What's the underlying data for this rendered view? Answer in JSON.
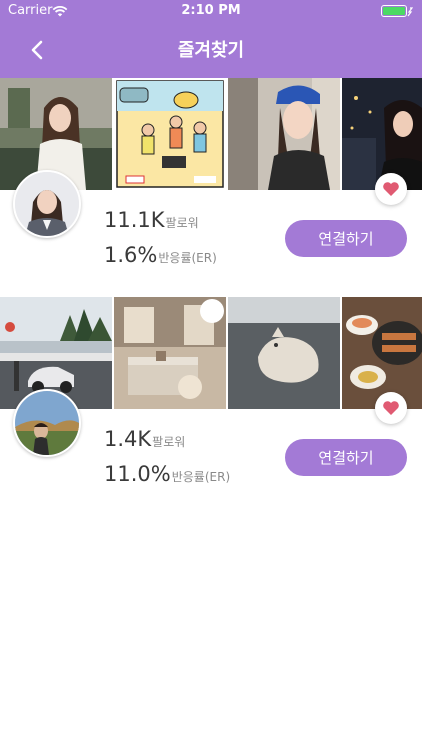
{
  "status_bar": {
    "carrier": "Carrier",
    "time": "2:10 PM",
    "battery_icon": "battery-full-icon",
    "wifi_icon": "wifi-icon"
  },
  "nav": {
    "title": "즐겨찾기",
    "back_icon": "chevron-left-icon"
  },
  "colors": {
    "accent": "#a37ad6",
    "heart": "#e05a72"
  },
  "influencers": [
    {
      "followers_value": "11.1K",
      "followers_label": "팔로워",
      "engagement_value": "1.6%",
      "engagement_label": "반응률(ER)",
      "connect_label": "연결하기",
      "favorite_icon": "heart-icon"
    },
    {
      "followers_value": "1.4K",
      "followers_label": "팔로워",
      "engagement_value": "11.0%",
      "engagement_label": "반응률(ER)",
      "connect_label": "연결하기",
      "favorite_icon": "heart-icon"
    }
  ]
}
